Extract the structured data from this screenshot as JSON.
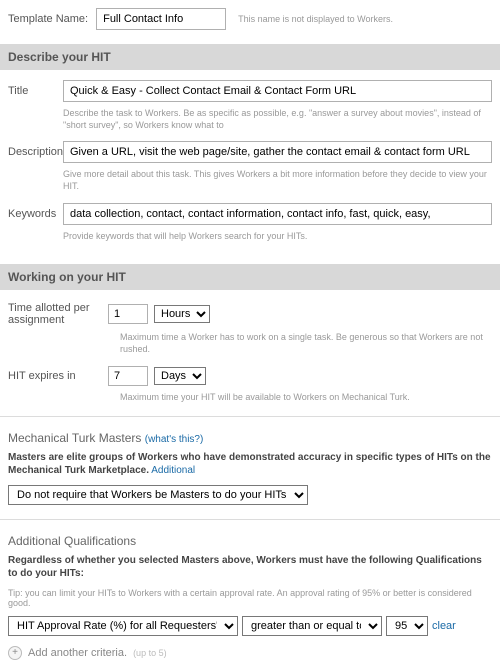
{
  "templateName": {
    "label": "Template Name:",
    "value": "Full Contact Info",
    "hint": "This name is not displayed to Workers."
  },
  "sections": {
    "describe": "Describe your HIT",
    "working": "Working on your HIT"
  },
  "title": {
    "label": "Title",
    "value": "Quick & Easy - Collect Contact Email & Contact Form URL",
    "hint": "Describe the task to Workers. Be as specific as possible, e.g. \"answer a survey about movies\", instead of \"short survey\", so Workers know what to"
  },
  "description": {
    "label": "Description",
    "value": "Given a URL, visit the web page/site, gather the contact email & contact form URL",
    "hint": "Give more detail about this task. This gives Workers a bit more information before they decide to view your HIT."
  },
  "keywords": {
    "label": "Keywords",
    "value": "data collection, contact, contact information, contact info, fast, quick, easy,",
    "hint": "Provide keywords that will help Workers search for your HITs."
  },
  "timeAllotted": {
    "label": "Time allotted per assignment",
    "value": "1",
    "unit": "Hours",
    "hint": "Maximum time a Worker has to work on a single task. Be generous so that Workers are not rushed."
  },
  "hitExpires": {
    "label": "HIT expires in",
    "value": "7",
    "unit": "Days",
    "hint": "Maximum time your HIT will be available to Workers on Mechanical Turk."
  },
  "masters": {
    "heading": "Mechanical Turk Masters",
    "whats": "(what's this?)",
    "desc": "Masters are elite groups of Workers who have demonstrated accuracy in specific types of HITs on the Mechanical Turk Marketplace.",
    "more": "Additional",
    "selected": "Do not require that Workers be Masters to do your HITs"
  },
  "qual": {
    "heading": "Additional Qualifications",
    "desc": "Regardless of whether you selected Masters above, Workers must have the following Qualifications to do your HITs:",
    "tip": "Tip: you can limit your HITs to Workers with a certain approval rate. An approval rating of 95% or better is considered good.",
    "type": "HIT Approval Rate (%) for all Requesters' HITs",
    "op": "greater than or equal to",
    "val": "95",
    "clear": "clear",
    "add": "Add another criteria.",
    "addHint": "(up to 5)"
  }
}
